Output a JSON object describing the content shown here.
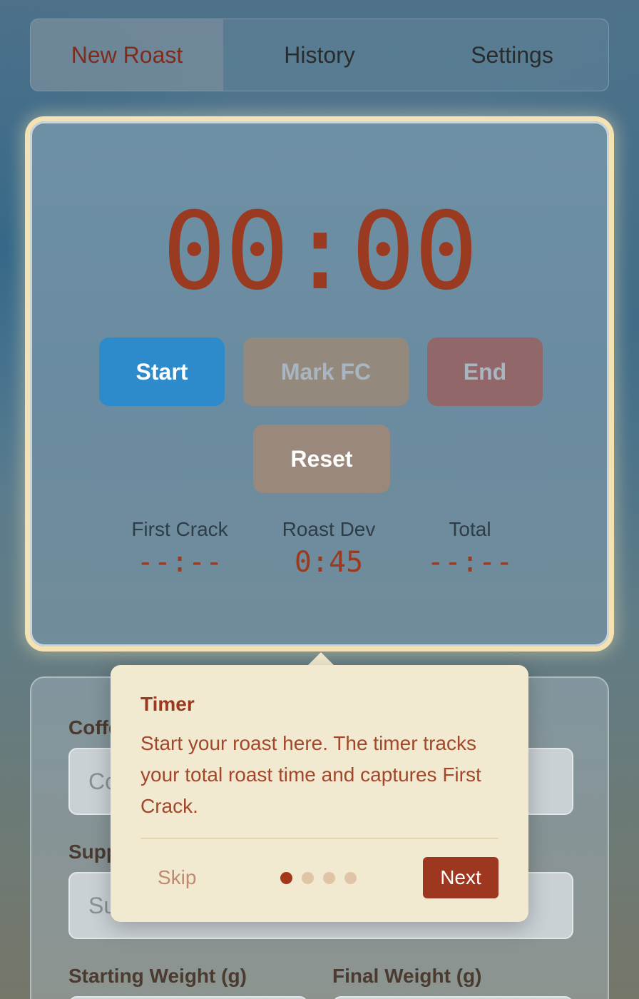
{
  "tabs": [
    {
      "label": "New Roast",
      "active": true
    },
    {
      "label": "History",
      "active": false
    },
    {
      "label": "Settings",
      "active": false
    }
  ],
  "timer": {
    "display": "00:00",
    "buttons": {
      "start": "Start",
      "mark_fc": "Mark FC",
      "end": "End",
      "reset": "Reset"
    },
    "stats": [
      {
        "label": "First Crack",
        "value": "--:--"
      },
      {
        "label": "Roast Dev",
        "value": "0:45"
      },
      {
        "label": "Total",
        "value": "--:--"
      }
    ]
  },
  "form": {
    "coffee_label": "Coffee",
    "coffee_placeholder": "Co",
    "supplier_label": "Supplier",
    "supplier_placeholder": "Su",
    "starting_weight_label": "Starting Weight (g)",
    "final_weight_label": "Final Weight (g)"
  },
  "tooltip": {
    "title": "Timer",
    "body": "Start your roast here. The timer tracks your total roast time and captures First Crack.",
    "skip": "Skip",
    "next": "Next",
    "step": 1,
    "total_steps": 4
  },
  "colors": {
    "accent": "#9a3a20",
    "start_button": "#2d8bcc",
    "highlight_ring": "#f5e2b3",
    "tooltip_bg": "#f1ead0"
  }
}
